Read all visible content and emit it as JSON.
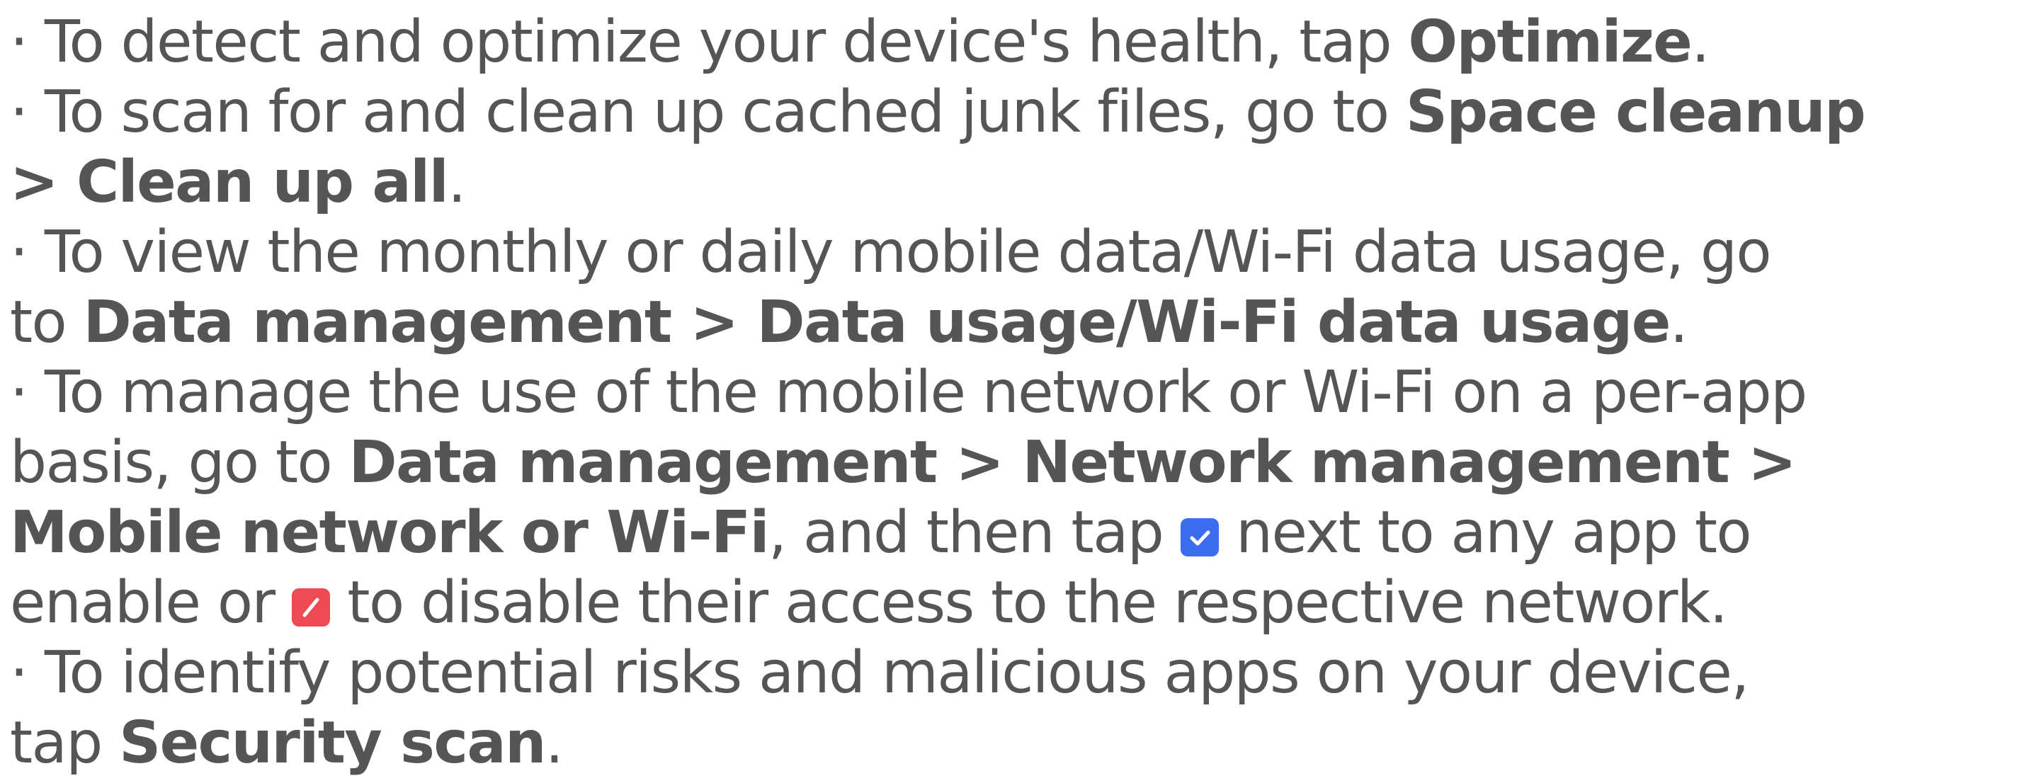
{
  "content": {
    "line1": {
      "text": "· To detect and optimize your device's health, tap ",
      "b1": "Optimize",
      "end": "."
    },
    "line2": {
      "text": "· To scan for and clean up cached junk files, go to ",
      "b1": "Space cleanup"
    },
    "line3": {
      "b1": "> Clean up all",
      "end": "."
    },
    "line4": {
      "text": "· To view the monthly or daily mobile data/Wi-Fi data usage, go"
    },
    "line5": {
      "pre": "to ",
      "b1": "Data management > Data usage/Wi-Fi data usage",
      "end": "."
    },
    "line6": {
      "text": "· To manage the use of the mobile network or Wi-Fi on a per-app"
    },
    "line7": {
      "pre": "basis, go to ",
      "b1": "Data management > Network management >"
    },
    "line8": {
      "b1": "Mobile network or Wi-Fi",
      "mid": ", and then tap ",
      "post": " next to any app to"
    },
    "line9": {
      "pre": "enable or ",
      "post": " to disable their access to the respective network."
    },
    "line10": {
      "text": "· To identify potential risks and malicious apps on your device,"
    },
    "line11": {
      "pre": "tap ",
      "b1": "Security scan",
      "end": "."
    },
    "icons": {
      "enable": {
        "name": "checkbox-checked-icon",
        "color": "#3b6cf0"
      },
      "disable": {
        "name": "checkbox-disabled-icon",
        "color": "#ee4a54"
      }
    }
  }
}
